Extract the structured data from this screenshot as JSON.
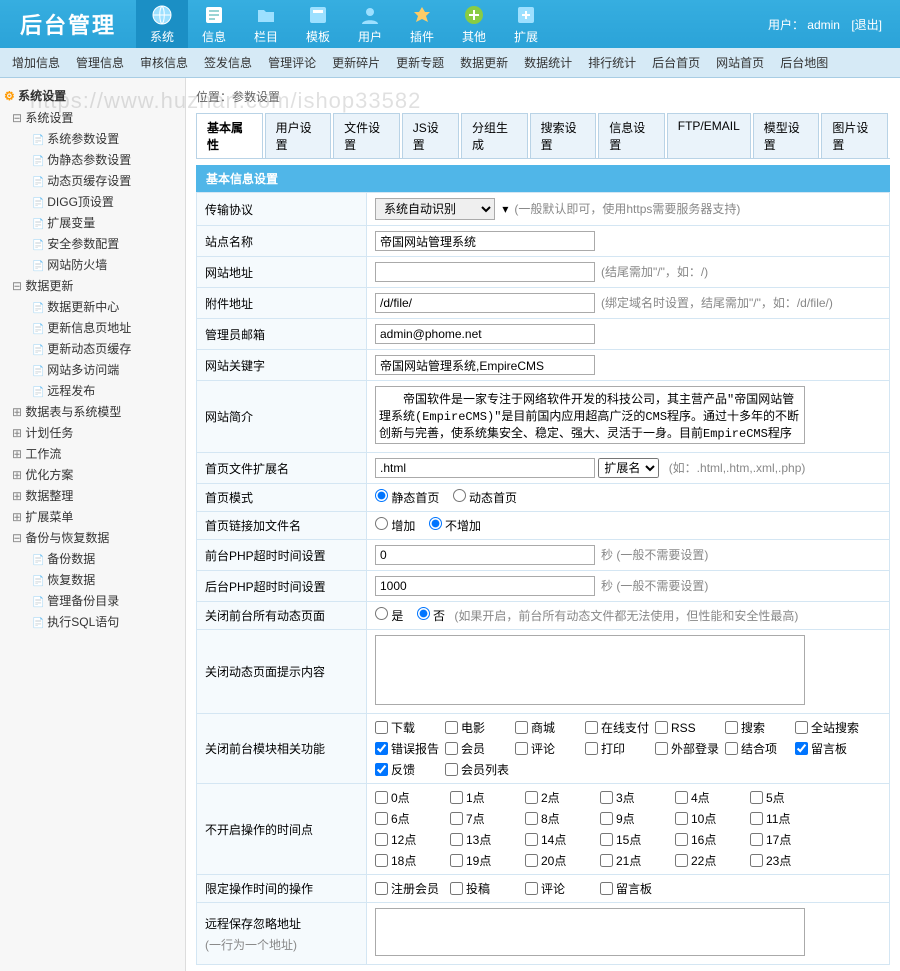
{
  "header": {
    "logo": "后台管理",
    "user_label": "用户：",
    "user_name": "admin",
    "logout": "[退出]"
  },
  "top_nav": [
    {
      "label": "系统",
      "icon": "globe",
      "active": true
    },
    {
      "label": "信息",
      "icon": "edit"
    },
    {
      "label": "栏目",
      "icon": "folder"
    },
    {
      "label": "模板",
      "icon": "template"
    },
    {
      "label": "用户",
      "icon": "user"
    },
    {
      "label": "插件",
      "icon": "plugin"
    },
    {
      "label": "其他",
      "icon": "add"
    },
    {
      "label": "扩展",
      "icon": "expand"
    }
  ],
  "sub_nav": [
    "增加信息",
    "管理信息",
    "审核信息",
    "签发信息",
    "管理评论",
    "更新碎片",
    "更新专题",
    "数据更新",
    "数据统计",
    "排行统计",
    "后台首页",
    "网站首页",
    "后台地图"
  ],
  "sidebar": {
    "root": "系统设置",
    "groups": [
      {
        "label": "系统设置",
        "open": true,
        "items": [
          "系统参数设置",
          "伪静态参数设置",
          "动态页缓存设置",
          "DIGG顶设置",
          "扩展变量",
          "安全参数配置",
          "网站防火墙"
        ]
      },
      {
        "label": "数据更新",
        "open": true,
        "items": [
          "数据更新中心",
          "更新信息页地址",
          "更新动态页缓存",
          "网站多访问端",
          "远程发布"
        ]
      },
      {
        "label": "数据表与系统模型",
        "open": false,
        "items": []
      },
      {
        "label": "计划任务",
        "open": false,
        "items": []
      },
      {
        "label": "工作流",
        "open": false,
        "items": []
      },
      {
        "label": "优化方案",
        "open": false,
        "items": []
      },
      {
        "label": "数据整理",
        "open": false,
        "items": []
      },
      {
        "label": "扩展菜单",
        "open": false,
        "items": []
      },
      {
        "label": "备份与恢复数据",
        "open": true,
        "items": [
          "备份数据",
          "恢复数据",
          "管理备份目录",
          "执行SQL语句"
        ]
      }
    ]
  },
  "breadcrumb": "位置：参数设置",
  "tabs": [
    "基本属性",
    "用户设置",
    "文件设置",
    "JS设置",
    "分组生成",
    "搜索设置",
    "信息设置",
    "FTP/EMAIL",
    "模型设置",
    "图片设置"
  ],
  "section_title": "基本信息设置",
  "form": {
    "protocol": {
      "label": "传输协议",
      "value": "系统自动识别",
      "hint": "(一般默认即可，使用https需要服务器支持)"
    },
    "site_name": {
      "label": "站点名称",
      "value": "帝国网站管理系统"
    },
    "site_url": {
      "label": "网站地址",
      "value": "",
      "hint": "(结尾需加\"/\"，如：/)"
    },
    "attach_url": {
      "label": "附件地址",
      "value": "/d/file/",
      "hint": "(绑定域名时设置，结尾需加\"/\"，如：/d/file/)"
    },
    "admin_email": {
      "label": "管理员邮箱",
      "value": "admin@phome.net"
    },
    "keywords": {
      "label": "网站关键字",
      "value": "帝国网站管理系统,EmpireCMS"
    },
    "description": {
      "label": "网站简介",
      "value": "　　帝国软件是一家专注于网络软件开发的科技公司，其主营产品\"帝国网站管理系统(EmpireCMS)\"是目前国内应用超高广泛的CMS程序。通过十多年的不断创新与完善，使系统集安全、稳定、强大、灵活于一身。目前EmpireCMS程序已经广泛应用在国内上百万家网站，覆盖国内数千万上网人群，并经过上千家知名网站的严格检测，被称为国内超高安全、"
    },
    "index_ext": {
      "label": "首页文件扩展名",
      "value": ".html",
      "select": "扩展名",
      "hint": "(如：.html,.htm,.xml,.php)"
    },
    "index_mode": {
      "label": "首页模式",
      "opt1": "静态首页",
      "opt2": "动态首页"
    },
    "index_link": {
      "label": "首页链接加文件名",
      "opt1": "增加",
      "opt2": "不增加"
    },
    "front_timeout": {
      "label": "前台PHP超时时间设置",
      "value": "0",
      "hint": "秒 (一般不需要设置)"
    },
    "back_timeout": {
      "label": "后台PHP超时时间设置",
      "value": "1000",
      "hint": "秒 (一般不需要设置)"
    },
    "close_front": {
      "label": "关闭前台所有动态页面",
      "opt1": "是",
      "opt2": "否",
      "hint": "(如果开启，前台所有动态文件都无法使用，但性能和安全性最高)"
    },
    "close_hint": {
      "label": "关闭动态页面提示内容",
      "value": ""
    },
    "close_modules": {
      "label": "关闭前台模块相关功能",
      "items": [
        {
          "label": "下载",
          "checked": false
        },
        {
          "label": "电影",
          "checked": false
        },
        {
          "label": "商城",
          "checked": false
        },
        {
          "label": "在线支付",
          "checked": false
        },
        {
          "label": "RSS",
          "checked": false
        },
        {
          "label": "搜索",
          "checked": false
        },
        {
          "label": "全站搜索",
          "checked": false
        },
        {
          "label": "错误报告",
          "checked": true
        },
        {
          "label": "会员",
          "checked": false
        },
        {
          "label": "评论",
          "checked": false
        },
        {
          "label": "打印",
          "checked": false
        },
        {
          "label": "外部登录",
          "checked": false
        },
        {
          "label": "结合项",
          "checked": false
        },
        {
          "label": "留言板",
          "checked": true
        },
        {
          "label": "反馈",
          "checked": true
        },
        {
          "label": "会员列表",
          "checked": false
        }
      ]
    },
    "time_disable": {
      "label": "不开启操作的时间点",
      "hours": [
        "0点",
        "1点",
        "2点",
        "3点",
        "4点",
        "5点",
        "6点",
        "7点",
        "8点",
        "9点",
        "10点",
        "11点",
        "12点",
        "13点",
        "14点",
        "15点",
        "16点",
        "17点",
        "18点",
        "19点",
        "20点",
        "21点",
        "22点",
        "23点"
      ]
    },
    "time_ops": {
      "label": "限定操作时间的操作",
      "items": [
        "注册会员",
        "投稿",
        "评论",
        "留言板"
      ]
    },
    "remote_ignore": {
      "label": "远程保存忽略地址",
      "hint": "(一行为一个地址)",
      "value": ""
    }
  },
  "watermark": "https://www.huzhan.com/ishop33582"
}
